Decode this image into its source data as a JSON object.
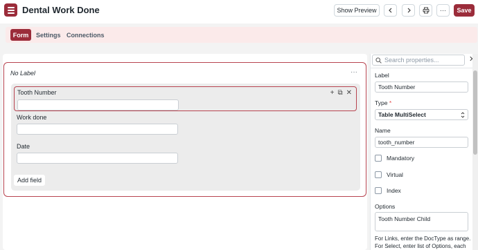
{
  "header": {
    "title": "Dental Work Done",
    "show_preview": "Show Preview",
    "save": "Save",
    "prev_icon": "chevron-left-icon",
    "next_icon": "chevron-right-icon",
    "print_icon": "printer-icon",
    "more_icon": "ellipsis-icon"
  },
  "tabs": [
    "Form",
    "Settings",
    "Connections"
  ],
  "section": {
    "label": "No Label",
    "more": "···"
  },
  "fields": [
    {
      "label": "Tooth Number"
    },
    {
      "label": "Work done"
    },
    {
      "label": "Date"
    }
  ],
  "add_field": "Add field",
  "field_actions": {
    "add": "+",
    "copy": "⧉",
    "remove": "✕"
  },
  "sidebar": {
    "search_placeholder": "Search properties...",
    "label_heading": "Label",
    "label_value": "Tooth Number",
    "type_heading": "Type",
    "type_required": "*",
    "type_value": "Table MultiSelect",
    "name_heading": "Name",
    "name_value": "tooth_number",
    "checks": [
      "Mandatory",
      "Virtual",
      "Index"
    ],
    "options_heading": "Options",
    "options_value": "Tooth Number Child",
    "help_line1": "For Links, enter the DocType as range.",
    "help_line2": "For Select, enter list of Options, each"
  },
  "colors": {
    "accent": "#9b2c3a",
    "tab_bg": "#fbeaea",
    "selection_border": "#b7434f"
  }
}
